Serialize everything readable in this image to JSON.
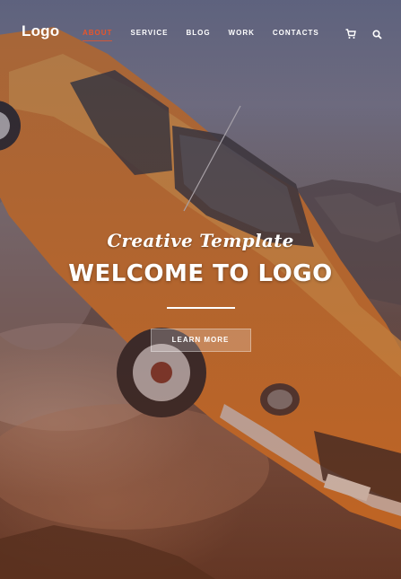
{
  "brand": {
    "logo_text": "Logo"
  },
  "nav": {
    "items": [
      {
        "label": "About",
        "active": true
      },
      {
        "label": "Service",
        "active": false
      },
      {
        "label": "Blog",
        "active": false
      },
      {
        "label": "Work",
        "active": false
      },
      {
        "label": "Contacts",
        "active": false
      }
    ],
    "cart_icon": "cart-icon",
    "search_icon": "search-icon"
  },
  "hero": {
    "script_title": "Creative Template",
    "title": "WELCOME TO LOGO",
    "cta_label": "LEARN MORE"
  },
  "colors": {
    "accent": "#e8552b",
    "text": "#ffffff"
  }
}
